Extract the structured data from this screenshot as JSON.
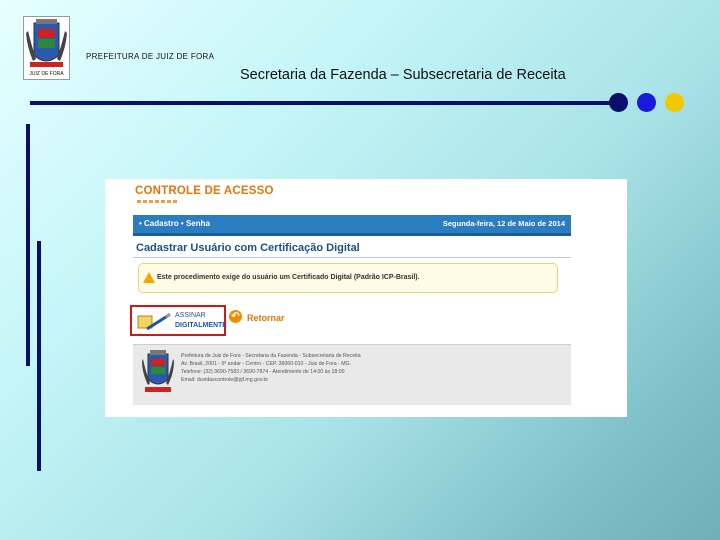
{
  "slide": {
    "org_name": "PREFEITURA DE JUIZ DE FORA",
    "subtitle": "Secretaria da Fazenda – Subsecretaria de Receita",
    "crest_text": "JUIZ DE FORA"
  },
  "colors": {
    "bar": "#0d0d6b",
    "dot_navy": "#0d0d6b",
    "dot_blue": "#1a1adb",
    "dot_yellow": "#f4c800",
    "brand_orange": "#e8740a",
    "nav_blue": "#2c7cc0",
    "highlight_red": "#d01818"
  },
  "app": {
    "brand": "CONTROLE DE ACESSO",
    "nav": {
      "links_text": "• Cadastro  • Senha",
      "date": "Segunda-feira, 12 de Maio de 2014"
    },
    "section_title": "Cadastrar Usuário com Certificação Digital",
    "notice": "Este procedimento exige do usuário um Certificado Digital (Padrão ICP-Brasil).",
    "sign_button": {
      "line1": "ASSINAR",
      "line2": "DIGITALMENTE",
      "icon": "certificate-pen-icon"
    },
    "back_button": {
      "label": "Retornar",
      "icon": "undo-arrow-icon"
    },
    "footer": {
      "line1": "Prefeitura de Juiz de Fora - Secretaria da Fazenda - Subsecretaria de Receita",
      "line2": "Av. Brasil, 2001 - 5º andar - Centro - CEP. 36060-010 - Juiz de Fora - MG.",
      "line3": "Telefone: (32) 3690-7583 / 3690-7874 - Atendimento de 14:00 às 18:00",
      "line4": "Email: duvidascontrole@pjf.mg.gov.br"
    }
  }
}
